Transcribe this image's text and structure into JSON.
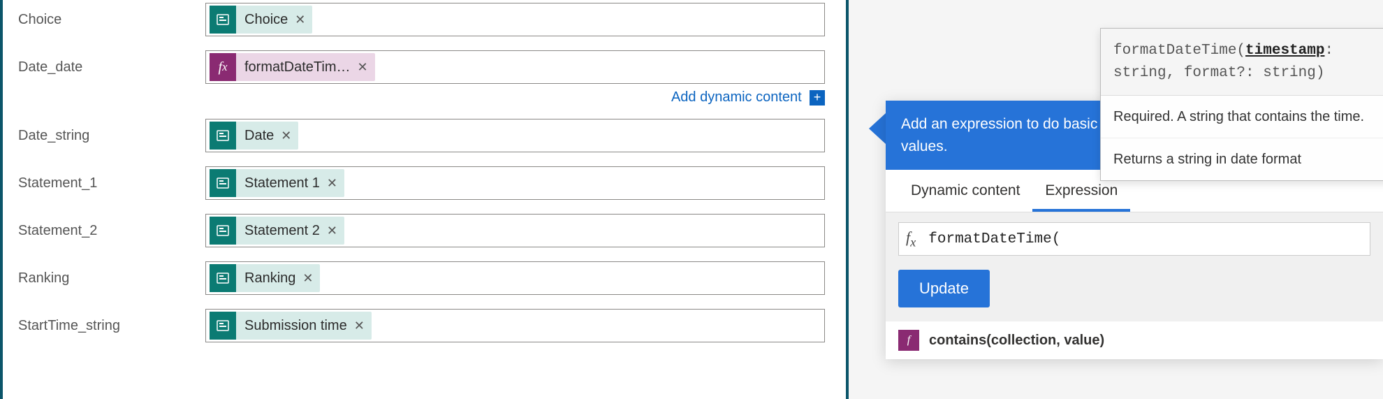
{
  "form": {
    "rows": [
      {
        "label": "Choice",
        "token_type": "forms",
        "token_text": "Choice"
      },
      {
        "label": "Date_date",
        "token_type": "fx",
        "token_text": "formatDateTim…",
        "has_add_link": true
      },
      {
        "label": "Date_string",
        "token_type": "forms",
        "token_text": "Date"
      },
      {
        "label": "Statement_1",
        "token_type": "forms",
        "token_text": "Statement 1"
      },
      {
        "label": "Statement_2",
        "token_type": "forms",
        "token_text": "Statement 2"
      },
      {
        "label": "Ranking",
        "token_type": "forms",
        "token_text": "Ranking"
      },
      {
        "label": "StartTime_string",
        "token_type": "forms",
        "token_text": "Submission time"
      }
    ],
    "add_dynamic_label": "Add dynamic content"
  },
  "panel": {
    "header_text": "Add an expression to do basic things like access, convert, and compare values.",
    "tab_dynamic": "Dynamic content",
    "tab_expression": "Expression",
    "expression_value": "formatDateTime(",
    "update_label": "Update",
    "func_item": "contains(collection, value)"
  },
  "tooltip": {
    "sig_prefix": "formatDateTime(",
    "sig_active_param": "timestamp",
    "sig_suffix": ": string, format?: string)",
    "desc": "Required. A string that contains the time.",
    "returns": "Returns a string in date format"
  }
}
